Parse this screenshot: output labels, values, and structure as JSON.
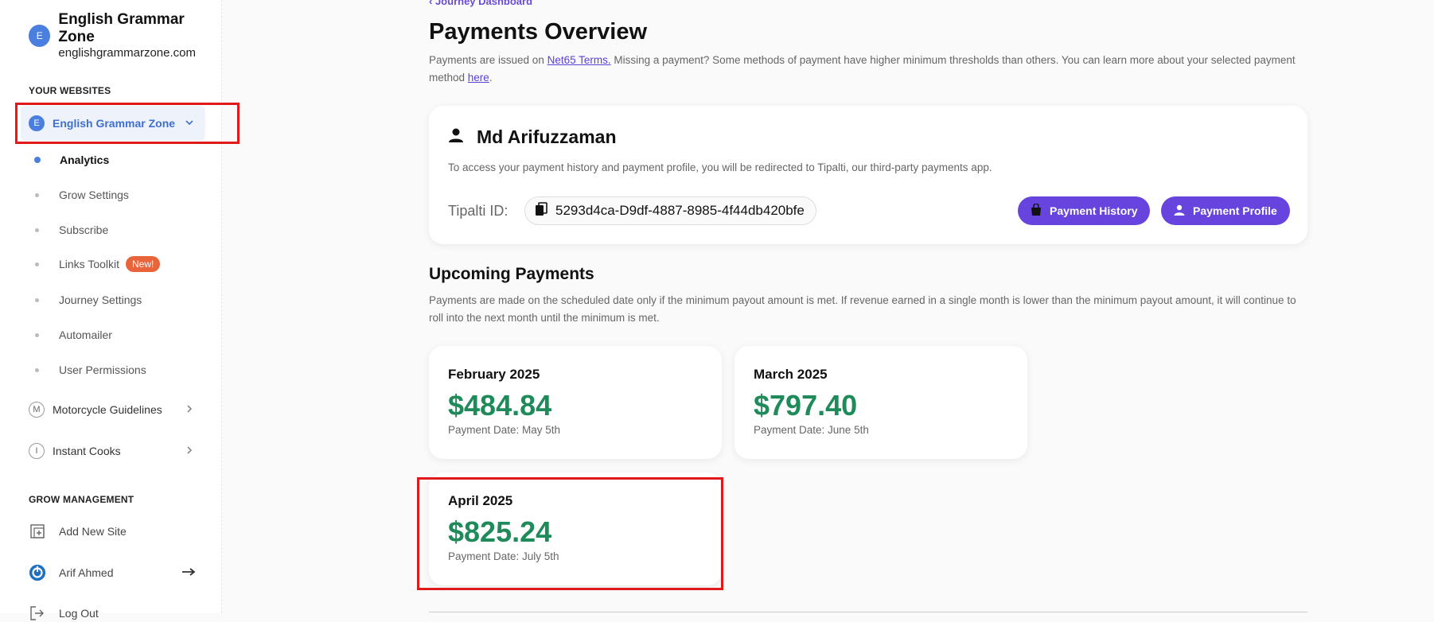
{
  "sidebar": {
    "brand": {
      "initial": "E",
      "title": "English Grammar Zone",
      "domain": "englishgrammarzone.com"
    },
    "your_websites_label": "YOUR WEBSITES",
    "active_site": {
      "initial": "E",
      "label": "English Grammar Zone"
    },
    "nav_items": [
      {
        "label": "Analytics"
      },
      {
        "label": "Grow Settings"
      },
      {
        "label": "Subscribe"
      },
      {
        "label": "Links Toolkit",
        "badge": "New!"
      },
      {
        "label": "Journey Settings"
      },
      {
        "label": "Automailer"
      },
      {
        "label": "User Permissions"
      }
    ],
    "other_sites": [
      {
        "initial": "M",
        "label": "Motorcycle Guidelines"
      },
      {
        "initial": "I",
        "label": "Instant Cooks"
      }
    ],
    "grow_management_label": "GROW MANAGEMENT",
    "add_new_site": "Add New Site",
    "user_name": "Arif Ahmed",
    "logout": "Log Out"
  },
  "main": {
    "breadcrumb": "Journey Dashboard",
    "title": "Payments Overview",
    "description": {
      "p1": "Payments are issued on ",
      "link1": "Net65 Terms.",
      "p2": " Missing a payment? Some methods of payment have higher minimum thresholds than others. You can learn more about your selected payment method ",
      "link2": "here",
      "p3": "."
    },
    "user_card": {
      "name": "Md Arifuzzaman",
      "note": "To access your payment history and payment profile, you will be redirected to Tipalti, our third-party payments app.",
      "tipalti_label": "Tipalti ID:",
      "tipalti_id": "5293d4ca-D9df-4887-8985-4f44db420bfe",
      "payment_history_btn": "Payment History",
      "payment_profile_btn": "Payment Profile"
    },
    "upcoming_title": "Upcoming Payments",
    "upcoming_desc": "Payments are made on the scheduled date only if the minimum payout amount is met. If revenue earned in a single month is lower than the minimum payout amount, it will continue to roll into the next month until the minimum is met.",
    "payments": [
      {
        "month": "February 2025",
        "amount": "$484.84",
        "date": "Payment Date: May 5th"
      },
      {
        "month": "March 2025",
        "amount": "$797.40",
        "date": "Payment Date: June 5th"
      },
      {
        "month": "April 2025",
        "amount": "$825.24",
        "date": "Payment Date: July 5th"
      }
    ]
  },
  "colors": {
    "accent": "#6644dd",
    "site_blue": "#4a7fe0",
    "amount_green": "#1f8a5a",
    "highlight_red": "#e01a1a"
  }
}
